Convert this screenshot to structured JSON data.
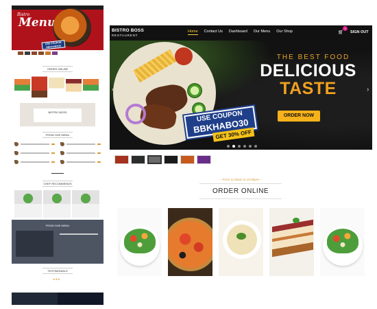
{
  "nav": {
    "logo_line1": "BISTRO BOSS",
    "logo_line2": "RESTAURENT",
    "links": [
      "Home",
      "Contact Us",
      "Dashboard",
      "Our Menu",
      "Our Shop"
    ],
    "active_link": "Home",
    "cart_icon": "cart-icon",
    "cart_count": "1",
    "signout": "SIGN OUT"
  },
  "banner": {
    "headline_small": "THE BEST FOOD",
    "headline_line1": "DELICIOUS",
    "headline_line2": "TASTE",
    "coupon_line1": "USE COUPON",
    "coupon_code": "BBKHABO30",
    "coupon_discount": "GET 30% OFF",
    "cta": "ORDER NOW",
    "prev_icon": "chevron-left-icon",
    "next_icon": "chevron-right-icon",
    "slide_count": 6,
    "active_slide": 1
  },
  "thumbnails": {
    "count": 6,
    "selected": 3
  },
  "order_online": {
    "subtitle": "---From 11:00am to 10:00pm---",
    "title": "ORDER ONLINE",
    "items": [
      {
        "name": "salad",
        "image": "salad-image"
      },
      {
        "name": "pizza",
        "image": "pizza-image"
      },
      {
        "name": "soup",
        "image": "soup-image"
      },
      {
        "name": "dessert",
        "image": "dessert-image"
      },
      {
        "name": "salad",
        "image": "salad-image"
      }
    ]
  },
  "preview": {
    "hero_brand_line1": "Bistro",
    "hero_brand_line2": "Menu",
    "hero_coupon_line1": "USE COUPON",
    "hero_coupon_code": "BBKHABO30",
    "sections": {
      "order_online": "ORDER ONLINE",
      "bistro_boss": "BISTRO BOSS",
      "from_our_menu": "FROM OUR MENU",
      "chef_recommends": "CHEF RECOMMENDS",
      "from_our_menu_featured": "FROM OUR MENU",
      "testimonials": "TESTIMONIALS"
    }
  },
  "colors": {
    "nav_bg": "#111111",
    "active_link": "#ffd43b",
    "accent_orange": "#f0a020",
    "cta_yellow": "#f6b21a",
    "coupon_blue": "#1f3f8a",
    "subtitle_gold": "#d99a36",
    "hero_red": "#b0121b"
  }
}
